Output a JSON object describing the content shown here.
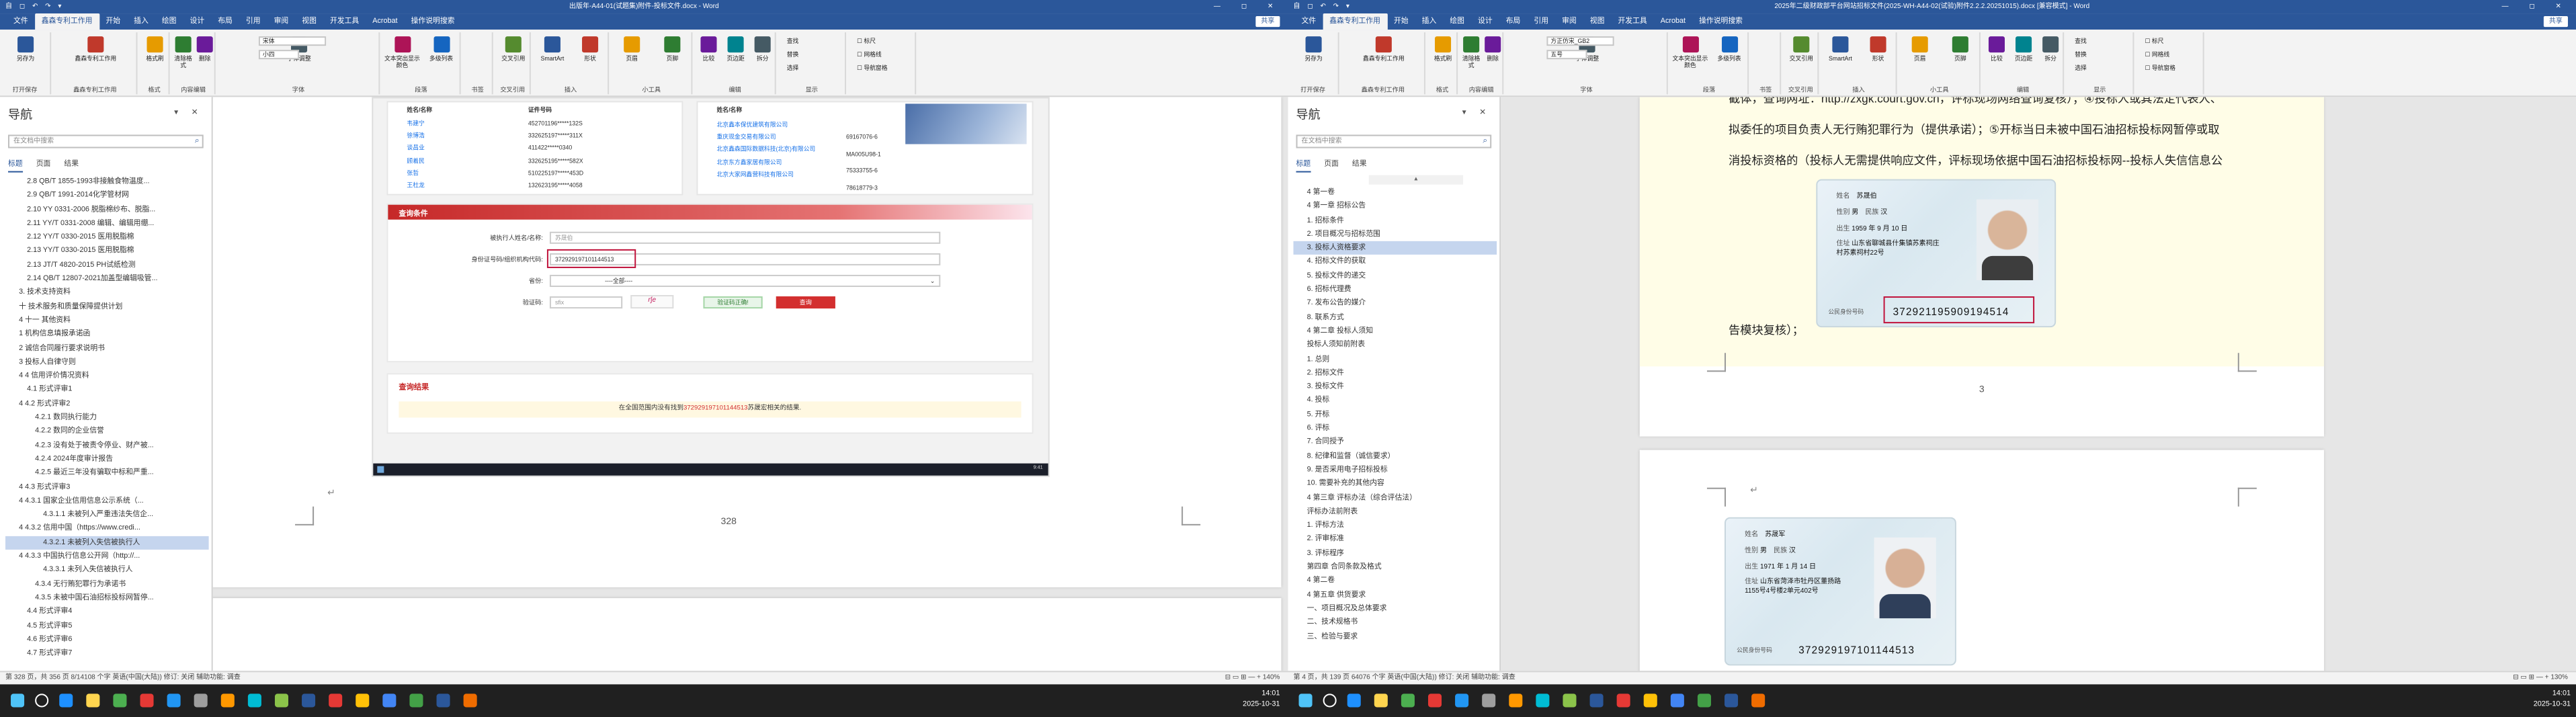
{
  "left_window": {
    "title": "出版年-A44-01(试题集)附件-投标文件.docx - Word",
    "quick_access": "自 ◻ ↶ ↷ ▾",
    "window_controls": "— ◻ ✕",
    "tabs": [
      "文件",
      "鑫森专利工作用",
      "开始",
      "插入",
      "绘图",
      "设计",
      "布局",
      "引用",
      "审阅",
      "视图",
      "开发工具",
      "Acrobat",
      "操作说明搜索"
    ],
    "active_tab": "鑫森专利工作用",
    "share_label": "共享",
    "ribbon": {
      "groups": [
        "打开保存",
        "鑫森专利工作用",
        "格式",
        "内容编辑",
        "字体",
        "段落",
        "书签",
        "交叉引用",
        "插入",
        "小工具",
        "编辑",
        "显示"
      ],
      "buttons": [
        "另存为",
        "鑫森专利工作用",
        "格式刷",
        "清除格式",
        "删除",
        "移动",
        "字体调整",
        "文本突出显示颜色",
        "多级列表",
        "交叉引用",
        "SmartArt",
        "形状",
        "页眉",
        "页脚",
        "比较",
        "页边距",
        "拆分"
      ],
      "font_name": "宋体",
      "font_size": "小四",
      "edit_items": [
        "查找",
        "替换",
        "选择"
      ],
      "show_items": [
        "标尺",
        "网格线",
        "导航窗格"
      ]
    },
    "nav": {
      "title": "导航",
      "search_placeholder": "在文档中搜索",
      "tabs": [
        "标题",
        "页面",
        "结果"
      ],
      "items": [
        "2.8 QB/T 1855-1993非接触食物温度...",
        "2.9 QB/T 1991-2014化学管材网",
        "2.10 YY 0331-2006 脱脂棉纱布、脱脂...",
        "2.11 YY/T 0331-2008 编辑、编辑用绷...",
        "2.12 YY/T 0330-2015 医用脱脂棉",
        "2.13 YY/T 0330-2015 医用脱脂棉",
        "2.13 JT/T 4820-2015 PH试纸检测",
        "2.14 QB/T 12807-2021加盖型编辑吸管...",
        "3. 技术支持资料",
        "十 技术服务和质量保障提供计划",
        "4 十一 其他资料",
        "1 机构信息填报承诺函",
        "2 诚信合同履行要求说明书",
        "3 投标人自律守则",
        "4 4 信用评价情况资料",
        "4.1 形式评审1",
        "4 4.2 形式评审2",
        "4.2.1 数同执行能力",
        "4.2.2 数同的企业信誉",
        "4.2.3 没有处于被责令停业、财产被...",
        "4.2.4 2024年度审计报告",
        "4.2.5 最近三年没有骗取中标和严重...",
        "4 4.3 形式评审3",
        "4 4.3.1 国家企业信用信息公示系统（...",
        "4.3.1.1 未被列入严重违法失信企...",
        "4 4.3.2 信用中国（https://www.credi...",
        "4.3.2.1 未被列入失信被执行人",
        "4 4.3.3 中国执行信息公开网（http://...",
        "4.3.3.1 未列入失信被执行人",
        "4.3.4 无行贿犯罪行为承诺书",
        "4.3.5 未被中国石油招标投标网暂停...",
        "4.4 形式评审4",
        "4.5 形式评审5",
        "4.6 形式评审6",
        "4.7 形式评审7"
      ],
      "selected_index": 26
    },
    "page_content": {
      "table_header": [
        "姓名/名称",
        "证件号码",
        "姓名/名称"
      ],
      "rows": [
        [
          "韦建宁",
          "452701196*****132S",
          "北京鑫本保优建筑有限公司"
        ],
        [
          "徐博浩",
          "332625197*****311X",
          "重庆现金交易有限公司"
        ],
        [
          "谈昌业",
          "411422*****0340",
          "北京鑫森国际数据科技(北京)有限公司"
        ],
        [
          "顾着民",
          "332625195*****582X",
          "北京东方鑫家居有限公司"
        ],
        [
          "张哲",
          "510225197*****453D",
          "北京大家网鑫营科技有限公司"
        ],
        [
          "王杜龙",
          "132623195*****4058",
          ""
        ]
      ],
      "right_codes": [
        "69167076-6",
        "MA005U98-1",
        "75333755-6",
        "78618779-3"
      ],
      "query_title": "查询条件",
      "name_label": "被执行人姓名/名称:",
      "name_placeholder": "苏晟伯",
      "id_label": "身份证号码/组织机构代码:",
      "id_value": "372929197101144513",
      "province_label": "省份:",
      "province_value": "----全部----",
      "captcha_label": "验证码:",
      "captcha_placeholder": "sfix",
      "captcha_code": "r∫e",
      "verify_button": "验证码正确!",
      "search_button": "查询",
      "result_title": "查询结果",
      "result_text_a": "在全国范围内没有找到",
      "result_id": "372929197101144513",
      "result_text_b": "苏晟宏相关的结果.",
      "page_number": "328",
      "shot_time": "9:41"
    },
    "status": {
      "left": "第 328 页，共 356 页   8/14108 个字   英语(中国(大陆))   修订: 关闭   辅助功能: 调查",
      "right": "⊟  ▭  ⊞   —  +   140%"
    }
  },
  "right_window": {
    "title": "2025年二级财政部平台网站招标文件(2025-WH-A44-02(试验)附件2.2.2.20251015).docx [兼容模式] - Word",
    "quick_access": "自 ◻ ↶ ↷ ▾",
    "window_controls": "— ◻ ✕",
    "tabs": [
      "文件",
      "鑫森专利工作用",
      "开始",
      "插入",
      "绘图",
      "设计",
      "布局",
      "引用",
      "审阅",
      "视图",
      "开发工具",
      "Acrobat",
      "操作说明搜索"
    ],
    "active_tab": "鑫森专利工作用",
    "share_label": "共享",
    "ribbon": {
      "font_name": "方正仿宋_GB2",
      "font_size": "五号",
      "edit_items": [
        "查找",
        "替换",
        "选择"
      ],
      "show_items": [
        "标尺",
        "网格线",
        "导航窗格"
      ]
    },
    "nav": {
      "title": "导航",
      "search_placeholder": "在文档中搜索",
      "tabs": [
        "标题",
        "页面",
        "结果"
      ],
      "items": [
        "4 第一卷",
        "4 第一章 招标公告",
        "1. 招标条件",
        "2. 项目概况与招标范围",
        "3. 投标人资格要求",
        "4. 招标文件的获取",
        "5. 投标文件的递交",
        "6. 招标代理费",
        "7. 发布公告的媒介",
        "8. 联系方式",
        "4 第二章 投标人须知",
        "投标人须知前附表",
        "1. 总则",
        "2. 招标文件",
        "3. 投标文件",
        "4. 投标",
        "5. 开标",
        "6. 评标",
        "7. 合同授予",
        "8. 纪律和监督（诚信要求）",
        "9. 是否采用电子招标投标",
        "10. 需要补充的其他内容",
        "4 第三章 评标办法（综合评估法）",
        "评标办法前附表",
        "1. 评标方法",
        "2. 评审标准",
        "3. 评标程序",
        "第四章 合同条款及格式",
        "4 第二卷",
        "4 第五章 供货要求",
        "一、项目概况及总体要求",
        "二、技术规格书",
        "三、检验与要求"
      ],
      "selected_index": 4
    },
    "page_content": {
      "line1": "截体，查询网址：http://zxgk.court.gov.cn，评标现场网络查询复核）；④投标人或其法定代表人、",
      "line2": "拟委任的项目负责人无行贿犯罪行为（提供承诺）；⑤开标当日未被中国石油招标投标网暂停或取",
      "line3": "消投标资格的（投标人无需提供响应文件，评标现场依据中国石油招标投标网--投标人失信信息公",
      "line4": "告模块复核）；",
      "page_num": "3",
      "card1": {
        "name": "苏晟伯",
        "sex": "男",
        "nation": "汉",
        "birth": "1959 年 9 月 10 日",
        "addr": "山东省聊城县什集镇苏素祠庄村苏素祠村22号",
        "id": "372921195909194514"
      },
      "card2": {
        "name": "苏晟军",
        "sex": "男",
        "nation": "汉",
        "birth": "1971 年 1 月 14 日",
        "addr": "山东省菏泽市牡丹区董扬路1155号4号楼2单元402号",
        "id": "372929197101144513"
      },
      "card_labels": {
        "name": "姓名",
        "sex": "性别",
        "nation": "民族",
        "birth": "出生",
        "addr": "住址",
        "id": "公民身份号码"
      }
    },
    "status": {
      "left": "第 4 页，共 139 页   64076 个字   英语(中国(大陆))   修订: 关闭   辅助功能: 调查",
      "right": "⊟  ▭  ⊞   —  +   130%"
    }
  },
  "taskbar": {
    "time": "14:01",
    "date": "2025-10-31",
    "icon_colors": [
      "#1e90ff",
      "#ffd54f",
      "#4caf50",
      "#e53935",
      "#2196f3",
      "#9e9e9e",
      "#ff9800",
      "#00bcd4",
      "#8bc34a",
      "#2b579a",
      "#e53935",
      "#ffc107",
      "#4285f4",
      "#43a047",
      "#2b579a",
      "#ef6c00"
    ]
  }
}
